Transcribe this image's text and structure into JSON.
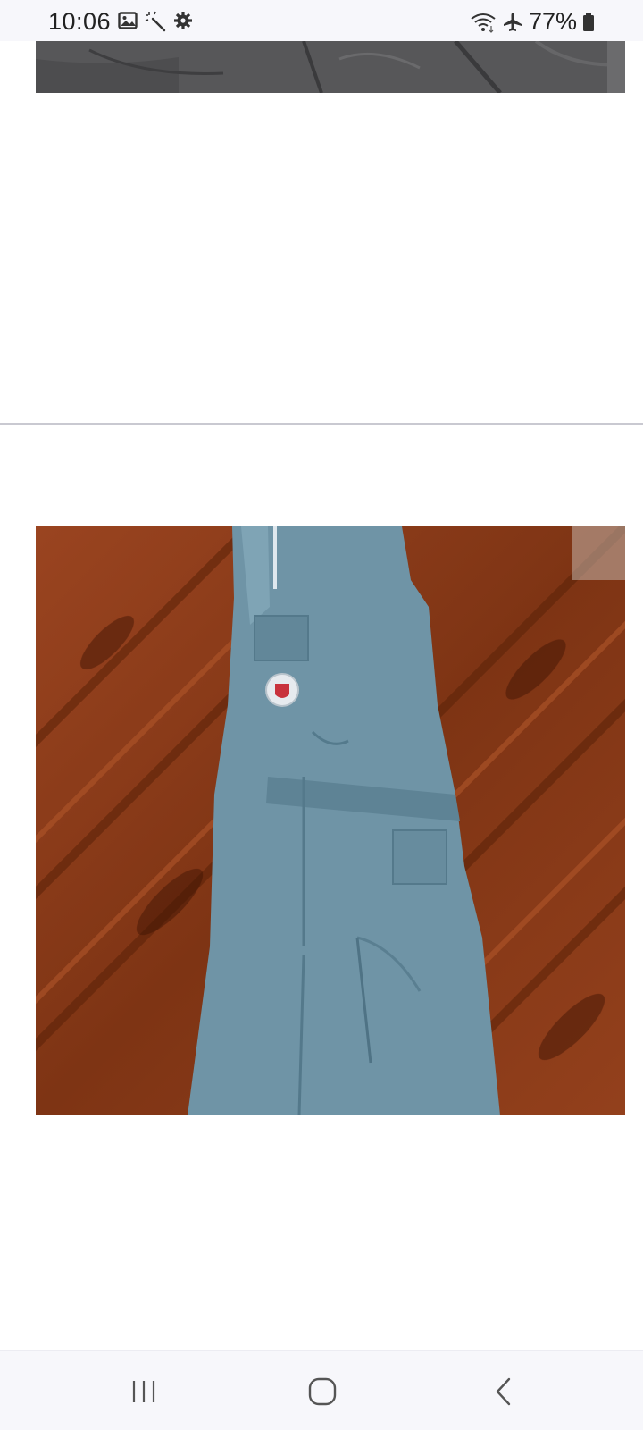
{
  "status_bar": {
    "time": "10:06",
    "left_icons": [
      "image-icon",
      "magic-wand-icon",
      "gear-icon"
    ],
    "right_icons": [
      "wifi-icon",
      "airplane-mode-icon",
      "battery-icon"
    ],
    "battery_percent": "77%"
  },
  "content": {
    "top_image": {
      "description_icon": "photo-grey-garment"
    },
    "main_image": {
      "description_icon": "photo-blue-coverall-on-wood-floor"
    }
  },
  "nav_bar": {
    "buttons": [
      "recents-icon",
      "home-icon",
      "back-icon"
    ]
  },
  "colors": {
    "status_bar_bg": "#f7f7fb",
    "divider": "#c9c9d1",
    "coverall_blue": "#6f94a6",
    "wood": "#8a3a16"
  }
}
